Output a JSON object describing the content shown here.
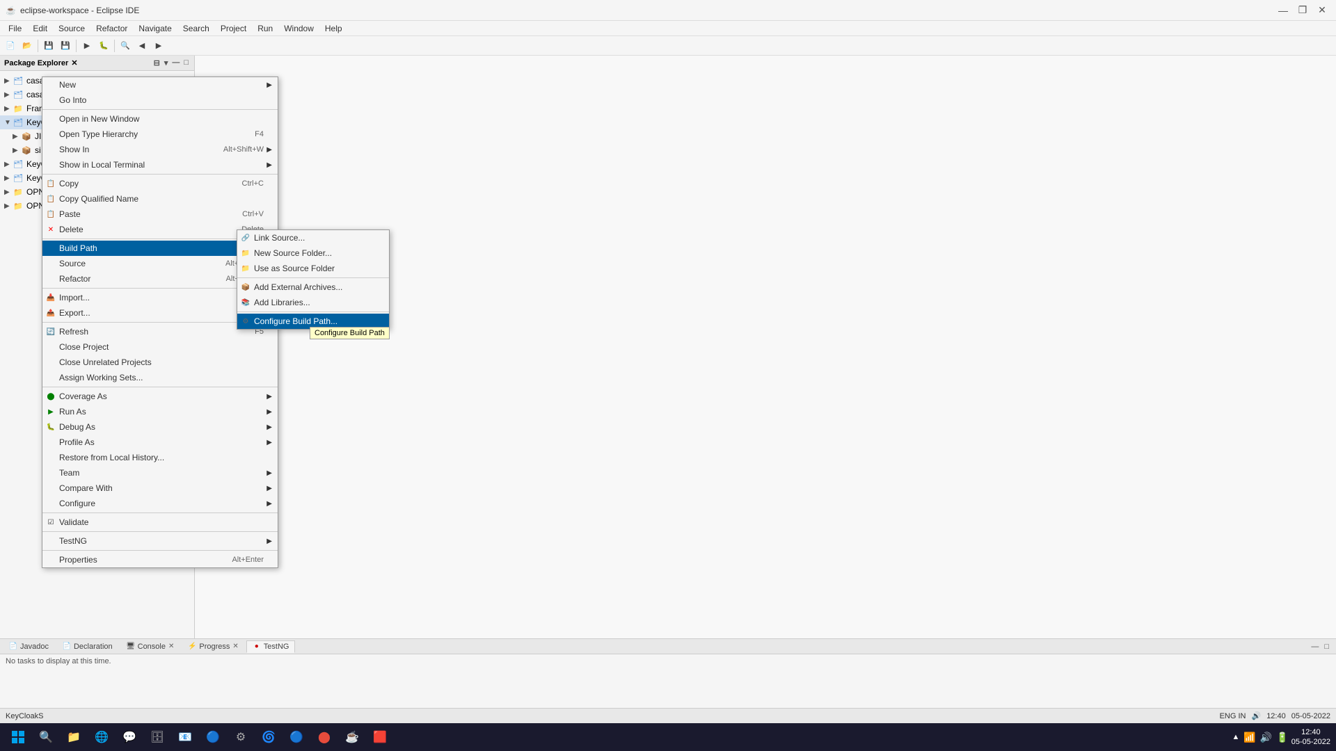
{
  "titlebar": {
    "title": "eclipse-workspace - Eclipse IDE",
    "icon": "☕",
    "minimize": "—",
    "restore": "❐",
    "close": "✕"
  },
  "menubar": {
    "items": [
      "File",
      "Edit",
      "Source",
      "Refactor",
      "Navigate",
      "Search",
      "Project",
      "Run",
      "Window",
      "Help"
    ]
  },
  "package_explorer": {
    "title": "Package Explorer",
    "close": "✕",
    "items": [
      {
        "label": "casandara",
        "level": 0,
        "type": "project",
        "expanded": false
      },
      {
        "label": "casandra-casandara",
        "level": 0,
        "type": "project",
        "expanded": false
      },
      {
        "label": "Fran",
        "level": 0,
        "type": "folder",
        "expanded": false
      },
      {
        "label": "KeyC",
        "level": 0,
        "type": "project",
        "expanded": true
      },
      {
        "label": "JI",
        "level": 1,
        "type": "folder"
      },
      {
        "label": "si",
        "level": 1,
        "type": "folder"
      },
      {
        "label": "KeyC",
        "level": 0,
        "type": "project",
        "expanded": false
      },
      {
        "label": "KeyC",
        "level": 0,
        "type": "project",
        "expanded": false
      },
      {
        "label": "OPN",
        "level": 0,
        "type": "project",
        "expanded": false
      },
      {
        "label": "OPN",
        "level": 0,
        "type": "project",
        "expanded": false
      }
    ]
  },
  "context_menu": {
    "items": [
      {
        "label": "New",
        "has_arrow": true,
        "shortcut": ""
      },
      {
        "label": "Go Into",
        "has_arrow": false,
        "shortcut": ""
      },
      {
        "type": "separator"
      },
      {
        "label": "Open in New Window",
        "has_arrow": false,
        "shortcut": ""
      },
      {
        "label": "Open Type Hierarchy",
        "has_arrow": false,
        "shortcut": "F4"
      },
      {
        "label": "Show In",
        "has_arrow": true,
        "shortcut": "Alt+Shift+W"
      },
      {
        "label": "Show in Local Terminal",
        "has_arrow": true,
        "shortcut": ""
      },
      {
        "type": "separator"
      },
      {
        "label": "Copy",
        "has_arrow": false,
        "shortcut": "Ctrl+C",
        "icon": "📋"
      },
      {
        "label": "Copy Qualified Name",
        "has_arrow": false,
        "shortcut": ""
      },
      {
        "label": "Paste",
        "has_arrow": false,
        "shortcut": "Ctrl+V",
        "icon": "📋"
      },
      {
        "label": "Delete",
        "has_arrow": false,
        "shortcut": "Delete",
        "icon": "✕"
      },
      {
        "type": "separator"
      },
      {
        "label": "Build Path",
        "has_arrow": true,
        "shortcut": "",
        "highlighted": true
      },
      {
        "label": "Source",
        "has_arrow": true,
        "shortcut": "Alt+Shift+S"
      },
      {
        "label": "Refactor",
        "has_arrow": true,
        "shortcut": "Alt+Shift+T"
      },
      {
        "type": "separator"
      },
      {
        "label": "Import...",
        "has_arrow": false,
        "shortcut": "",
        "icon": "📥"
      },
      {
        "label": "Export...",
        "has_arrow": false,
        "shortcut": "",
        "icon": "📤"
      },
      {
        "type": "separator"
      },
      {
        "label": "Refresh",
        "has_arrow": false,
        "shortcut": "F5",
        "icon": "🔄"
      },
      {
        "label": "Close Project",
        "has_arrow": false,
        "shortcut": ""
      },
      {
        "label": "Close Unrelated Projects",
        "has_arrow": false,
        "shortcut": ""
      },
      {
        "label": "Assign Working Sets...",
        "has_arrow": false,
        "shortcut": ""
      },
      {
        "type": "separator"
      },
      {
        "label": "Coverage As",
        "has_arrow": true,
        "shortcut": "",
        "icon": "🟢"
      },
      {
        "label": "Run As",
        "has_arrow": true,
        "shortcut": "",
        "icon": "▶"
      },
      {
        "label": "Debug As",
        "has_arrow": true,
        "shortcut": "",
        "icon": "🐛"
      },
      {
        "label": "Profile As",
        "has_arrow": true,
        "shortcut": ""
      },
      {
        "label": "Restore from Local History...",
        "has_arrow": false,
        "shortcut": ""
      },
      {
        "label": "Team",
        "has_arrow": true,
        "shortcut": ""
      },
      {
        "label": "Compare With",
        "has_arrow": true,
        "shortcut": ""
      },
      {
        "label": "Configure",
        "has_arrow": true,
        "shortcut": ""
      },
      {
        "type": "separator"
      },
      {
        "label": "Validate",
        "has_arrow": false,
        "shortcut": "",
        "icon": "☑"
      },
      {
        "type": "separator"
      },
      {
        "label": "TestNG",
        "has_arrow": true,
        "shortcut": ""
      },
      {
        "type": "separator"
      },
      {
        "label": "Properties",
        "has_arrow": false,
        "shortcut": "Alt+Enter"
      }
    ]
  },
  "submenu_buildpath": {
    "items": [
      {
        "label": "Link Source...",
        "icon": "🔗"
      },
      {
        "label": "New Source Folder...",
        "icon": "📁"
      },
      {
        "label": "Use as Source Folder",
        "icon": "📁"
      },
      {
        "label": "Add External Archives...",
        "icon": "📦"
      },
      {
        "label": "Add Libraries...",
        "icon": "📚"
      },
      {
        "label": "Configure Build Path...",
        "highlighted": true,
        "icon": "⚙"
      }
    ]
  },
  "tooltip": {
    "text": "Configure Build Path"
  },
  "bottom_panel": {
    "tabs": [
      {
        "label": "Javadoc",
        "icon": "📄",
        "active": false
      },
      {
        "label": "Declaration",
        "icon": "📄",
        "active": false
      },
      {
        "label": "Console",
        "icon": "🖥",
        "active": false,
        "closable": true
      },
      {
        "label": "Progress",
        "icon": "⚡",
        "active": false,
        "closable": true
      },
      {
        "label": "TestNG",
        "icon": "🔴",
        "active": true
      }
    ],
    "content": "No tasks to display at this time."
  },
  "statusbar": {
    "left": "KeyCloakS",
    "right_items": [
      "ENG IN",
      "🔊",
      "12:40",
      "05-05-2022"
    ]
  },
  "taskbar": {
    "time": "12:40",
    "date": "05-05-2022",
    "apps": [
      {
        "icon": "⊞",
        "name": "windows-start"
      },
      {
        "icon": "🔍",
        "name": "search"
      },
      {
        "icon": "📁",
        "name": "file-explorer"
      },
      {
        "icon": "🌐",
        "name": "edge"
      },
      {
        "icon": "💬",
        "name": "teams"
      },
      {
        "icon": "🗄",
        "name": "sql"
      },
      {
        "icon": "📧",
        "name": "mail"
      },
      {
        "icon": "🔵",
        "name": "app1"
      },
      {
        "icon": "⚙",
        "name": "settings"
      },
      {
        "icon": "🌀",
        "name": "app2"
      },
      {
        "icon": "🌊",
        "name": "app3"
      },
      {
        "icon": "🔶",
        "name": "app4"
      },
      {
        "icon": "🟥",
        "name": "app5"
      }
    ],
    "sys_icons": [
      "▲",
      "🔊",
      "🔋",
      "📶"
    ]
  }
}
